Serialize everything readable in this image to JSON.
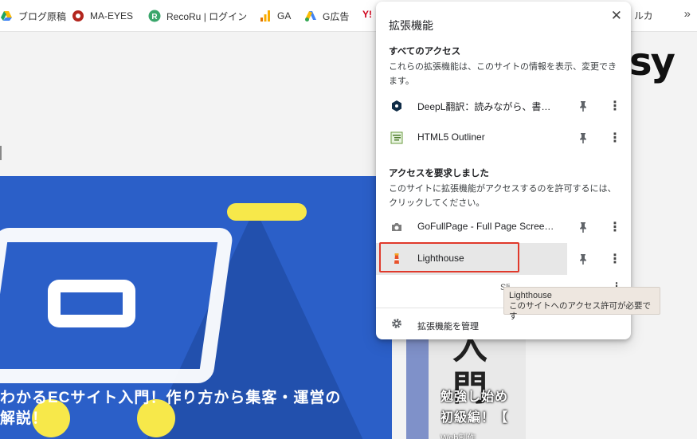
{
  "bookmarks": {
    "items": [
      {
        "label": "ブログ原稿",
        "icon": "google-drive-icon",
        "color": "#1fa463"
      },
      {
        "label": "MA-EYES",
        "icon": "ma-eyes-icon",
        "color": "#b3261e"
      },
      {
        "label": "RecoRu | ログイン",
        "icon": "recoru-icon",
        "color": "#3aa66b"
      },
      {
        "label": "GA",
        "icon": "analytics-icon",
        "color": "#f9ab00"
      },
      {
        "label": "G広告",
        "icon": "google-ads-icon",
        "color": "#4285f4"
      }
    ],
    "partial_label": "ルカ",
    "yahoo_glyph": "Y!"
  },
  "page": {
    "logo_text": "sy",
    "hero_title": "わかるECサイト入門！作り方から集客・運営の解説！",
    "hero_title_line1": "わかるECサイト入門！作り方から集客・運営の",
    "hero_title_line2": "解説！",
    "card2_big": "入\n門",
    "card2_title_line1": "勉強し始め",
    "card2_title_line2": "初級編！【",
    "card2_category": "Web制作"
  },
  "popup": {
    "title": "拡張機能",
    "close_glyph": "✕",
    "section_all_access": {
      "heading": "すべてのアクセス",
      "description": "これらの拡張機能は、このサイトの情報を表示、変更できます。"
    },
    "section_requested": {
      "heading": "アクセスを要求しました",
      "description": "このサイトに拡張機能がアクセスするのを許可するには、クリックしてください。"
    },
    "extensions_all": [
      {
        "name": "DeepL翻訳：読みながら、書き…",
        "icon": "deepl-icon"
      },
      {
        "name": "HTML5 Outliner",
        "icon": "html5-outliner-icon"
      }
    ],
    "extensions_requested": [
      {
        "name": "GoFullPage - Full Page Scree…",
        "icon": "camera-icon"
      },
      {
        "name": "Lighthouse",
        "icon": "lighthouse-icon"
      }
    ],
    "partial_row_text": "Sli",
    "manage_label": "拡張機能を管理"
  },
  "tooltip": {
    "title": "Lighthouse",
    "text": "このサイトへのアクセス許可が必要です"
  },
  "colors": {
    "focus_outline": "#e0392b",
    "hero_bg": "#2b5fc8",
    "accent_yellow": "#f7e84a"
  }
}
